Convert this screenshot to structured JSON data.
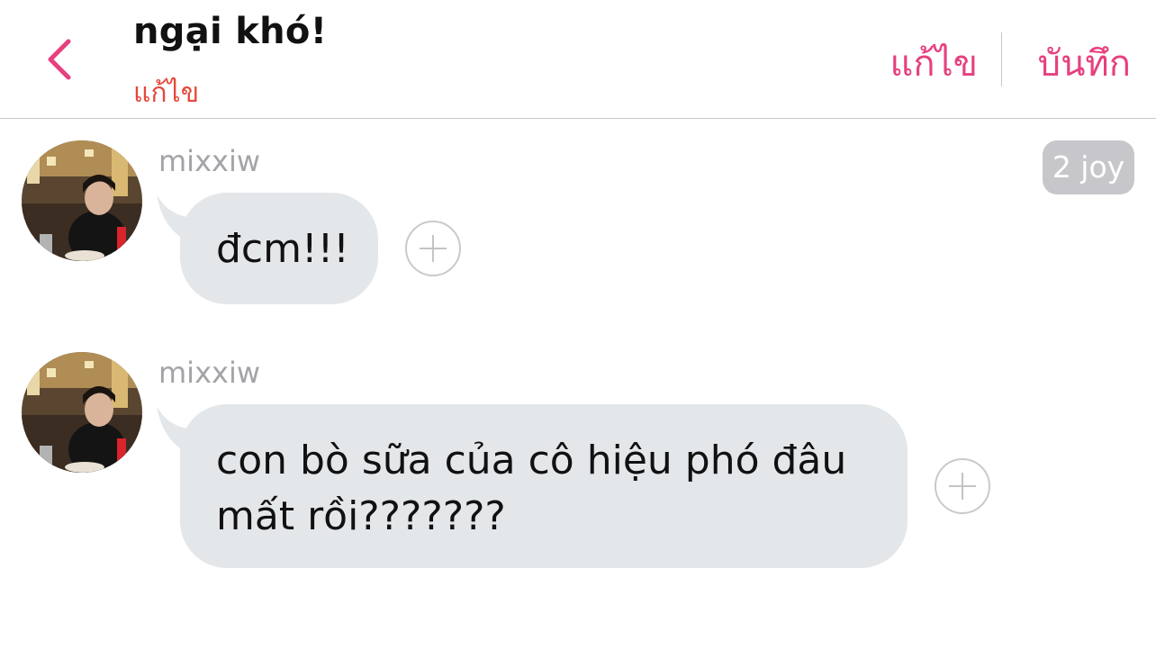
{
  "header": {
    "title": "ngại khó!",
    "subtitle": "แก้ไข",
    "edit_label": "แก้ไข",
    "save_label": "บันทึก"
  },
  "messages": [
    {
      "sender": "mixxiw",
      "text": "đcm!!!",
      "badge": "2 joy"
    },
    {
      "sender": "mixxiw",
      "text": "con bò sữa của cô hiệu phó đâu mất rồi???????"
    }
  ],
  "colors": {
    "accent": "#e6407f",
    "subtitle": "#e5483c",
    "bubble": "#e4e7ea",
    "badge": "#c7c7cb"
  }
}
